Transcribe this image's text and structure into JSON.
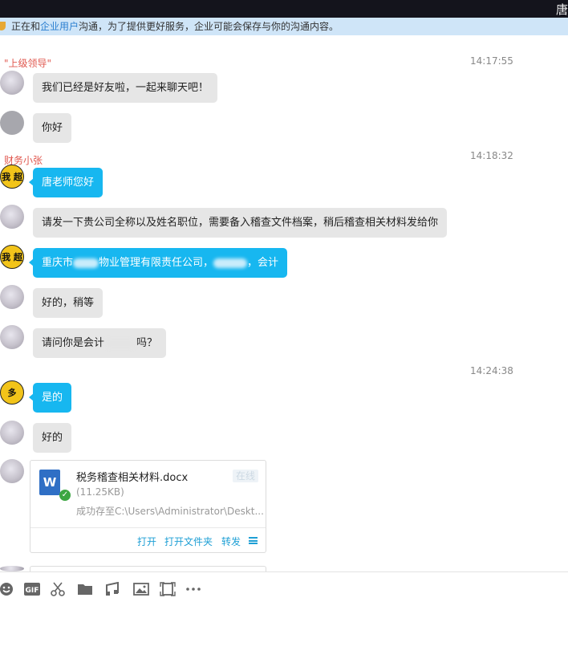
{
  "window": {
    "title": "唐"
  },
  "notice": {
    "prefix": "正在和",
    "link": "企业用户",
    "suffix": "沟通，为了提供更好服务，企业可能会保存与你的沟通内容。"
  },
  "timestamps": [
    "14:17:55",
    "14:18:32",
    "14:24:38"
  ],
  "senders": {
    "leader": "\"上级领导\"",
    "finance": "财务小张"
  },
  "messages": [
    {
      "text": "我们已经是好友啦，一起来聊天吧！"
    },
    {
      "text": "你好"
    },
    {
      "text": "唐老师您好"
    },
    {
      "text": "请发一下贵公司全称以及姓名职位，需要备入稽查文件档案，稍后稽查相关材料发给你"
    },
    {
      "part1": "重庆市",
      "part2": "物业管理有限责任公司，",
      "part3": "，会计"
    },
    {
      "text": "好的，稍等"
    },
    {
      "part1": "请问你是会计",
      "part2": "吗？"
    },
    {
      "text": "是的"
    },
    {
      "text": "好的"
    }
  ],
  "file": {
    "name": "税务稽查相关材料.docx",
    "status": "在线",
    "size": "(11.25KB)",
    "saved": "成功存至C:\\Users\\Administrator\\Deskt...",
    "actions": {
      "open": "打开",
      "open_folder": "打开文件夹",
      "forward": "转发"
    }
  },
  "avatars": {
    "finance_text_1": "我\n超",
    "finance_text_2": "多"
  },
  "toolbar": [
    "emoji-icon",
    "gif-icon",
    "screenshot-icon",
    "folder-icon",
    "music-icon",
    "image-icon",
    "screen-share-icon",
    "more-icon"
  ],
  "colors": {
    "blue_bubble": "#17b7f0",
    "gray_bubble": "#e6e6e6",
    "sender_name": "#e0584f",
    "link": "#2b7fd0"
  }
}
